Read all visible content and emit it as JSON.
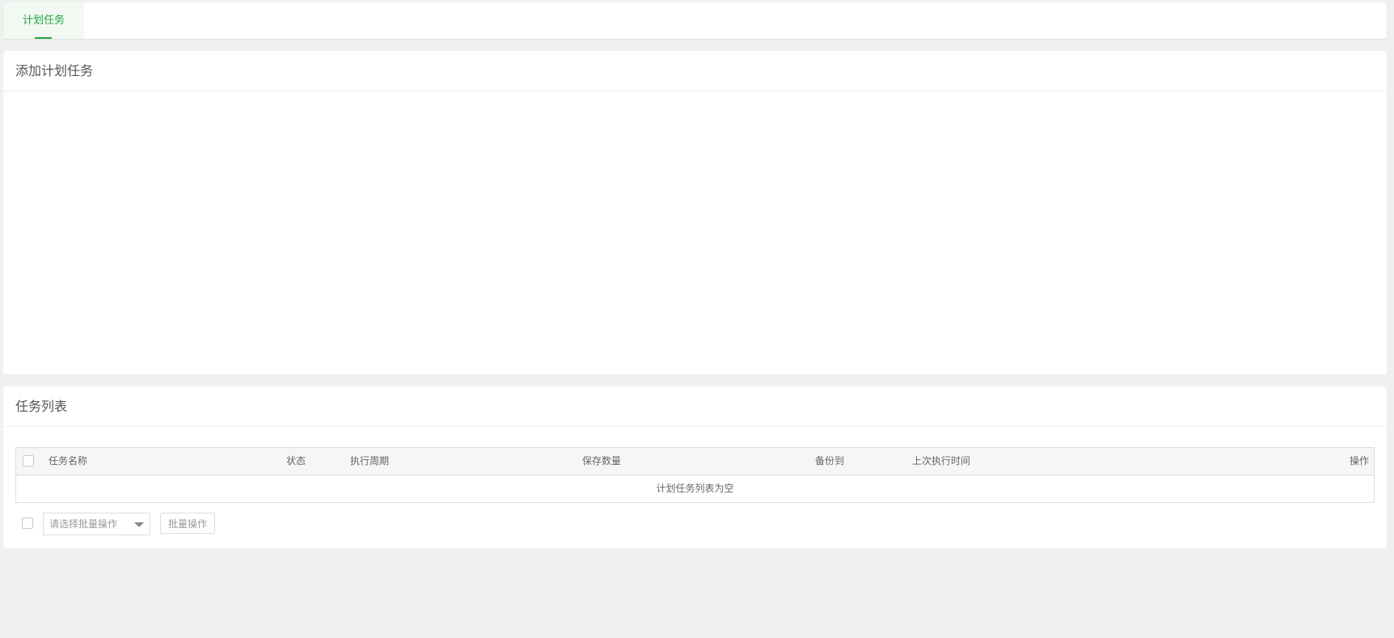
{
  "tabs": [
    {
      "label": "计划任务",
      "active": true
    }
  ],
  "add_panel": {
    "title": "添加计划任务"
  },
  "list_panel": {
    "title": "任务列表",
    "columns": [
      "任务名称",
      "状态",
      "执行周期",
      "保存数量",
      "备份到",
      "上次执行时间",
      "操作"
    ],
    "empty_text": "计划任务列表为空",
    "batch": {
      "select_placeholder": "请选择批量操作",
      "button_label": "批量操作"
    }
  },
  "colors": {
    "accent": "#20a53a",
    "page_bg": "#f0f0f0"
  }
}
